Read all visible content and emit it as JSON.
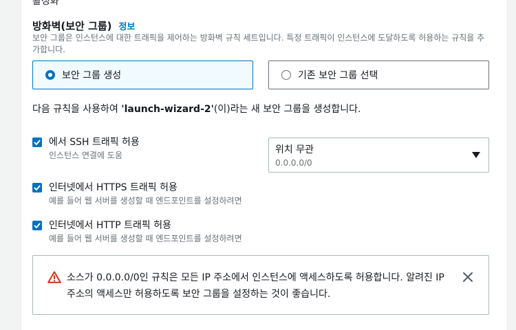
{
  "header": {
    "cut_label": "활성화"
  },
  "firewall": {
    "title": "방화벽(보안 그룹)",
    "info_link": "정보",
    "description": "보안 그룹은 인스턴스에 대한 트래픽을 제어하는 방화벽 규칙 세트입니다. 특정 트래픽이 인스턴스에 도달하도록 허용하는 규칙을 추가합니다.",
    "options": [
      {
        "label": "보안 그룹 생성",
        "selected": true
      },
      {
        "label": "기존 보안 그룹 선택",
        "selected": false
      }
    ],
    "rule_sentence_prefix": "다음 규칙을 사용하여 ",
    "group_name": "'launch-wizard-2'",
    "rule_sentence_suffix": "(이)라는 새 보안 그룹을 생성합니다."
  },
  "rules": [
    {
      "label": "에서 SSH 트래픽 허용",
      "sub": "인스턴스 연결에 도움",
      "checked": true
    },
    {
      "label": "인터넷에서 HTTPS 트래픽 허용",
      "sub": "예를 들어 웹 서버를 생성할 때 엔드포인트를 설정하려면",
      "checked": true
    },
    {
      "label": "인터넷에서 HTTP 트래픽 허용",
      "sub": "예를 들어 웹 서버를 생성할 때 엔드포인트를 설정하려면",
      "checked": true
    }
  ],
  "ssh_source": {
    "value": "위치 무관",
    "sub": "0.0.0.0/0"
  },
  "alert": {
    "text": "소스가 0.0.0.0/0인 규칙은 모든 IP 주소에서 인스턴스에 액세스하도록 허용합니다. 알려진 IP 주소의 액세스만 허용하도록 보안 그룹을 설정하는 것이 좋습니다."
  },
  "colors": {
    "accent": "#0073bb",
    "warning": "#d13212",
    "text": "#16191f",
    "muted": "#687078"
  },
  "icons": {
    "radio_on": "radio-selected-icon",
    "radio_off": "radio-unselected-icon",
    "check": "checkmark-icon",
    "caret": "caret-down-icon",
    "warning": "warning-icon",
    "close": "close-icon"
  }
}
